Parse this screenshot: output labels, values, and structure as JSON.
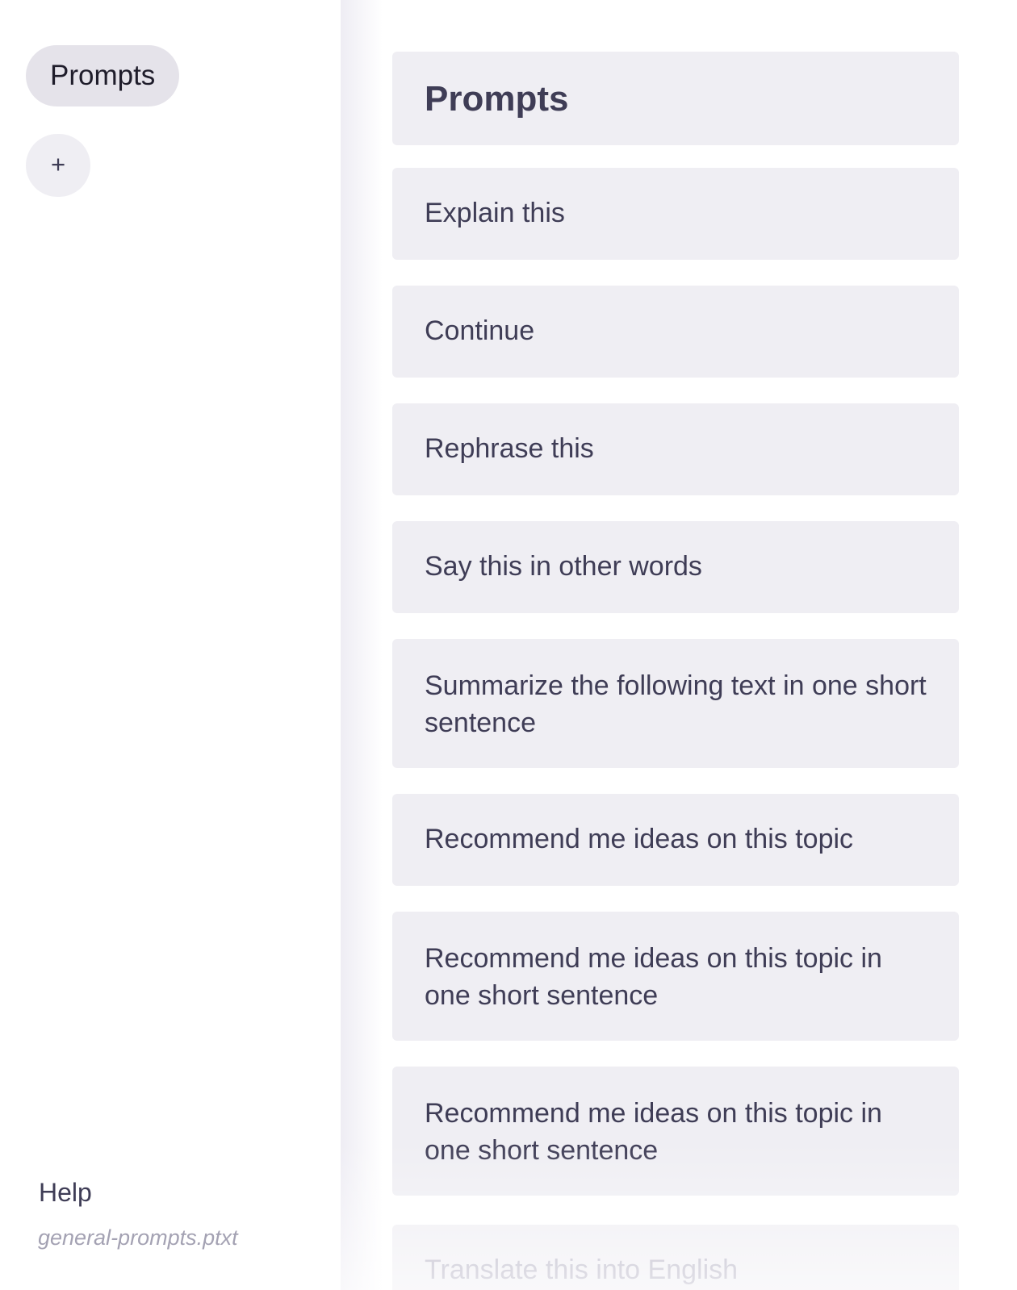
{
  "sidebar": {
    "active_label": "Prompts",
    "add_label": "+",
    "help_label": "Help",
    "file_name": "general-prompts.ptxt"
  },
  "main": {
    "title": "Prompts",
    "prompts": [
      "Explain this",
      "Continue",
      "Rephrase this",
      "Say this in other words",
      "Summarize the following text in one short sentence",
      "Recommend me ideas on this topic",
      "Recommend me ideas on this topic in one short sentence",
      "Recommend me ideas on this topic in one short sentence",
      "Translate this into English"
    ]
  },
  "colors": {
    "sidebar_background": "#ffffff",
    "pill_background": "#e5e3ea",
    "card_background": "#efeef3",
    "text": "#3f3d56",
    "muted_text": "#a4a2b3"
  }
}
